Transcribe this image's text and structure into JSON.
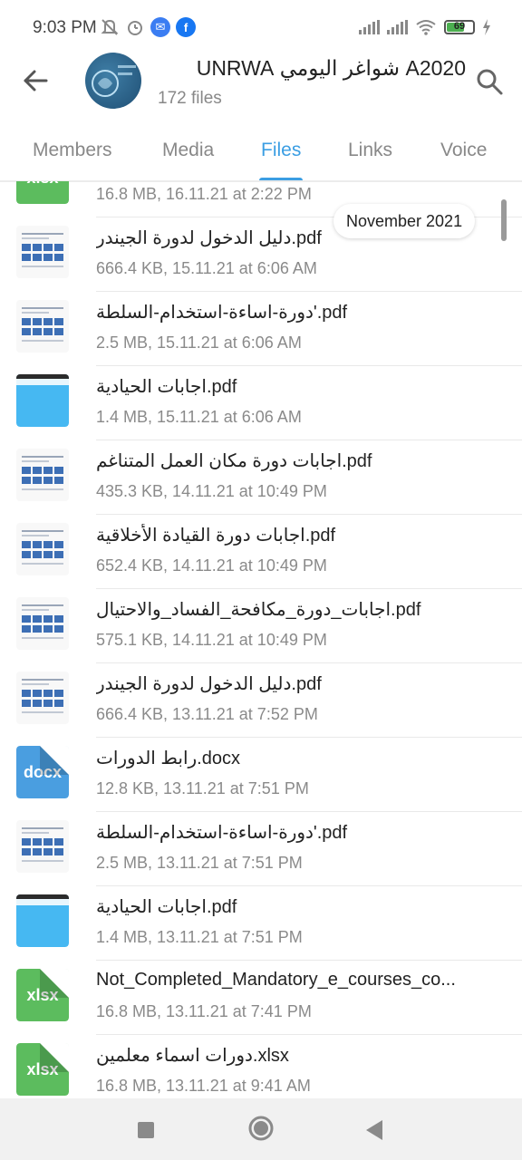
{
  "status_bar": {
    "time": "9:03 PM",
    "battery_level": "69",
    "battery_fraction": 0.69,
    "icons": [
      "mute-icon",
      "alarm-icon",
      "messenger-icon",
      "facebook-icon",
      "signal-icon",
      "signal-icon",
      "wifi-icon",
      "battery-icon",
      "charging-icon"
    ]
  },
  "header": {
    "title": "A2020 شواغر اليومي UNRWA",
    "subtitle": "172 files",
    "back_icon": "arrow-left-icon",
    "search_icon": "search-icon"
  },
  "tabs": [
    {
      "label": "Members",
      "active": false
    },
    {
      "label": "Media",
      "active": false
    },
    {
      "label": "Files",
      "active": true
    },
    {
      "label": "Links",
      "active": false
    },
    {
      "label": "Voice",
      "active": false
    }
  ],
  "date_pill": "November 2021",
  "files": [
    {
      "name": "",
      "meta": "16.8 MB, 16.11.21 at 2:22 PM",
      "type": "xlsx",
      "ext_label": "xlsx",
      "color": "#5cbc5e"
    },
    {
      "name": "دليل الدخول لدورة الجيندر.pdf",
      "meta": "666.4 KB, 15.11.21 at 6:06 AM",
      "type": "doc-preview"
    },
    {
      "name": "دورة-اساءة-استخدام-السلطة'.pdf",
      "meta": "2.5 MB, 15.11.21 at 6:06 AM",
      "type": "doc-preview"
    },
    {
      "name": "اجابات الحيادية.pdf",
      "meta": "1.4 MB, 15.11.21 at 6:06 AM",
      "type": "blue-preview"
    },
    {
      "name": "اجابات  دورة مكان العمل المتناغم.pdf",
      "meta": "435.3 KB, 14.11.21 at 10:49 PM",
      "type": "doc-preview"
    },
    {
      "name": "اجابات دورة القيادة الأخلاقية.pdf",
      "meta": "652.4 KB, 14.11.21 at 10:49 PM",
      "type": "doc-preview"
    },
    {
      "name": "اجابات_دورة_مكافحة_الفساد_والاحتيال.pdf",
      "meta": "575.1 KB, 14.11.21 at 10:49 PM",
      "type": "doc-preview"
    },
    {
      "name": "دليل الدخول لدورة الجيندر.pdf",
      "meta": "666.4 KB, 13.11.21 at 7:52 PM",
      "type": "doc-preview"
    },
    {
      "name": "رابط الدورات.docx",
      "meta": "12.8 KB, 13.11.21 at 7:51 PM",
      "type": "docx",
      "ext_label": "docx",
      "color": "#4a9ee0"
    },
    {
      "name": "دورة-اساءة-استخدام-السلطة'.pdf",
      "meta": "2.5 MB, 13.11.21 at 7:51 PM",
      "type": "doc-preview"
    },
    {
      "name": "اجابات الحيادية.pdf",
      "meta": "1.4 MB, 13.11.21 at 7:51 PM",
      "type": "blue-preview"
    },
    {
      "name": "Not_Completed_Mandatory_e_courses_co...",
      "meta": "16.8 MB, 13.11.21 at 7:41 PM",
      "type": "xlsx",
      "ext_label": "xlsx",
      "color": "#5cbc5e"
    },
    {
      "name": "دورات اسماء معلمين.xlsx",
      "meta": "16.8 MB, 13.11.21 at 9:41 AM",
      "type": "xlsx",
      "ext_label": "xlsx",
      "color": "#5cbc5e"
    }
  ],
  "nav_bar": {
    "icons": [
      "recents-square-icon",
      "home-circle-icon",
      "back-triangle-icon"
    ]
  }
}
